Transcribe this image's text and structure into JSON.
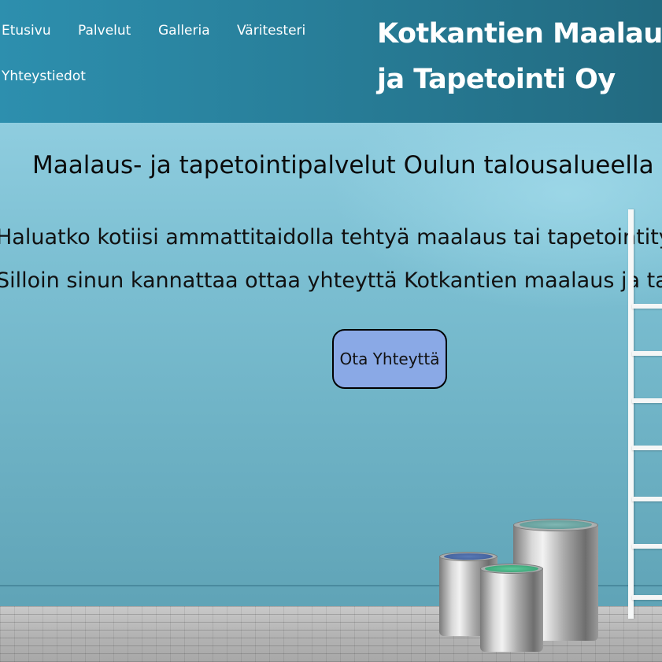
{
  "nav": {
    "items": [
      "Etusivu",
      "Palvelut",
      "Galleria",
      "Väritesteri",
      "Yhteystiedot"
    ]
  },
  "header": {
    "site_title": "Kotkantien Maalaus ja Tapetointi Oy"
  },
  "hero": {
    "heading": "Maalaus- ja tapetointipalvelut Oulun talousalueella",
    "line_1": "Haluatko kotiisi ammattitaidolla tehtyä maalaus tai tapetointityötä?",
    "line_2": "Silloin sinun kannattaa ottaa yhteyttä Kotkantien maalaus ja tapetointiin.",
    "button_label": "Ota Yhteyttä"
  },
  "colors": {
    "header_bg": "#287f9a",
    "button_bg": "#8aa9e6",
    "wall": "#7dc0d3"
  },
  "icons": {
    "ladder": "ladder-image",
    "paint_cans": "paint-cans-image"
  }
}
